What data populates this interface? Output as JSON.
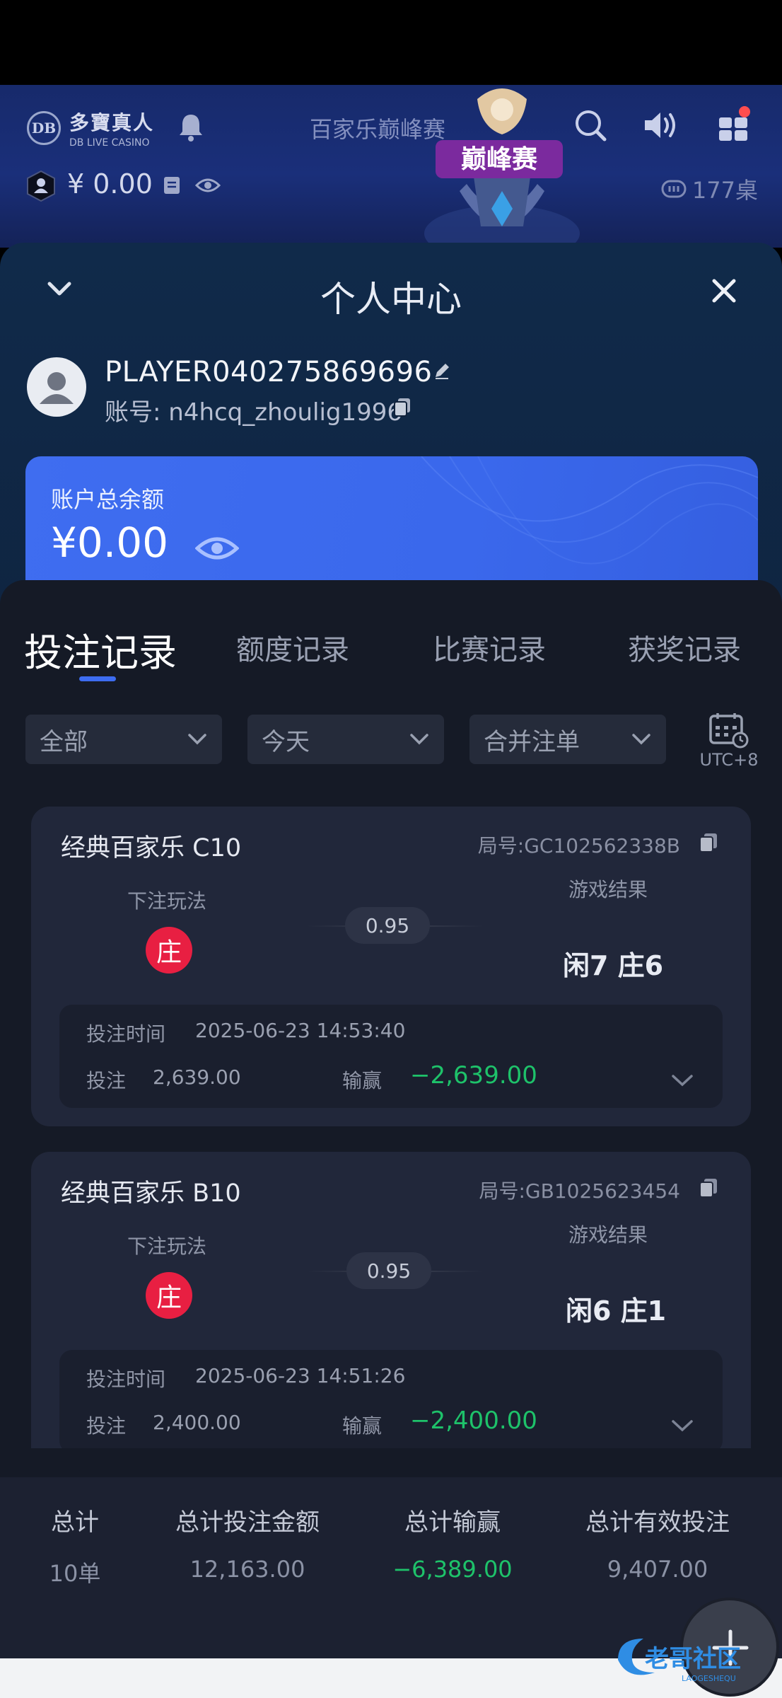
{
  "header": {
    "logo_main": "多寶真人",
    "logo_sub": "DB LIVE CASINO",
    "logo_badge": "DB",
    "title": "百家乐巅峰赛",
    "emblem_text": "巅峰赛",
    "balance": "¥ 0.00",
    "tables": "177桌"
  },
  "sheet": {
    "title": "个人中心",
    "username": "PLAYER040275869696",
    "account": "账号: n4hcq_zhoulig1996",
    "balance_label": "账户总余额",
    "balance_amount": "¥0.00"
  },
  "tabs": [
    {
      "label": "投注记录",
      "active": true
    },
    {
      "label": "额度记录",
      "active": false
    },
    {
      "label": "比赛记录",
      "active": false
    },
    {
      "label": "获奖记录",
      "active": false
    }
  ],
  "filters": {
    "type": "全部",
    "date": "今天",
    "merge": "合并注单",
    "timezone": "UTC+8"
  },
  "records": [
    {
      "game": "经典百家乐 C10",
      "round": "局号:GC102562338B",
      "bet_label": "下注玩法",
      "bet_type": "庄",
      "odds": "0.95",
      "result_label": "游戏结果",
      "result": "闲7 庄6",
      "time_label": "投注时间",
      "time": "2025-06-23 14:53:40",
      "stake_label": "投注",
      "stake": "2,639.00",
      "winloss_label": "输赢",
      "winloss": "−2,639.00"
    },
    {
      "game": "经典百家乐 B10",
      "round": "局号:GB1025623454",
      "bet_label": "下注玩法",
      "bet_type": "庄",
      "odds": "0.95",
      "result_label": "游戏结果",
      "result": "闲6 庄1",
      "time_label": "投注时间",
      "time": "2025-06-23 14:51:26",
      "stake_label": "投注",
      "stake": "2,400.00",
      "winloss_label": "输赢",
      "winloss": "−2,400.00"
    }
  ],
  "totals": {
    "count_label": "总计",
    "count": "10单",
    "stake_label": "总计投注金额",
    "stake": "12,163.00",
    "winloss_label": "总计输赢",
    "winloss": "−6,389.00",
    "valid_label": "总计有效投注",
    "valid": "9,407.00"
  },
  "watermark": {
    "main": "老哥社区",
    "sub": "LAOGESHEQU"
  },
  "colors": {
    "accent": "#3d6cf0",
    "loss": "#1ec26a",
    "banker": "#e81f42"
  }
}
